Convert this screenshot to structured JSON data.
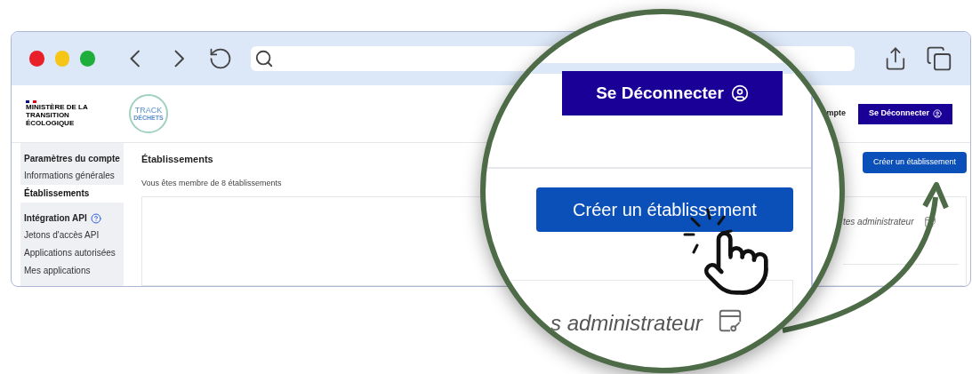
{
  "header": {
    "ministry_logo": "MINISTÈRE DE LA TRANSITION ÉCOLOGIQUE",
    "logo_line_1": "TRACK",
    "logo_line_2": "DÉCHETS",
    "account_label": "mpte",
    "logout_button": "Se Déconnecter"
  },
  "sidebar": {
    "sections": [
      {
        "title": "Paramètres du compte",
        "help": false,
        "items": [
          {
            "label": "Informations générales",
            "selected": false
          },
          {
            "label": "Établissements",
            "selected": true
          }
        ]
      },
      {
        "title": "Intégration API",
        "help": true,
        "items": [
          {
            "label": "Jetons d'accès API",
            "selected": false
          },
          {
            "label": "Applications autorisées",
            "selected": false
          },
          {
            "label": "Mes applications",
            "selected": false
          }
        ]
      }
    ]
  },
  "main": {
    "title": "Établissements",
    "subtitle": "Vous êtes membre de 8 établissements",
    "create_button": "Créer un établissement",
    "card_text": "tes administrateur"
  },
  "magnifier": {
    "logout_button": "Se Déconnecter",
    "create_button": "Créer un établissement",
    "card_text": "s administrateur"
  }
}
